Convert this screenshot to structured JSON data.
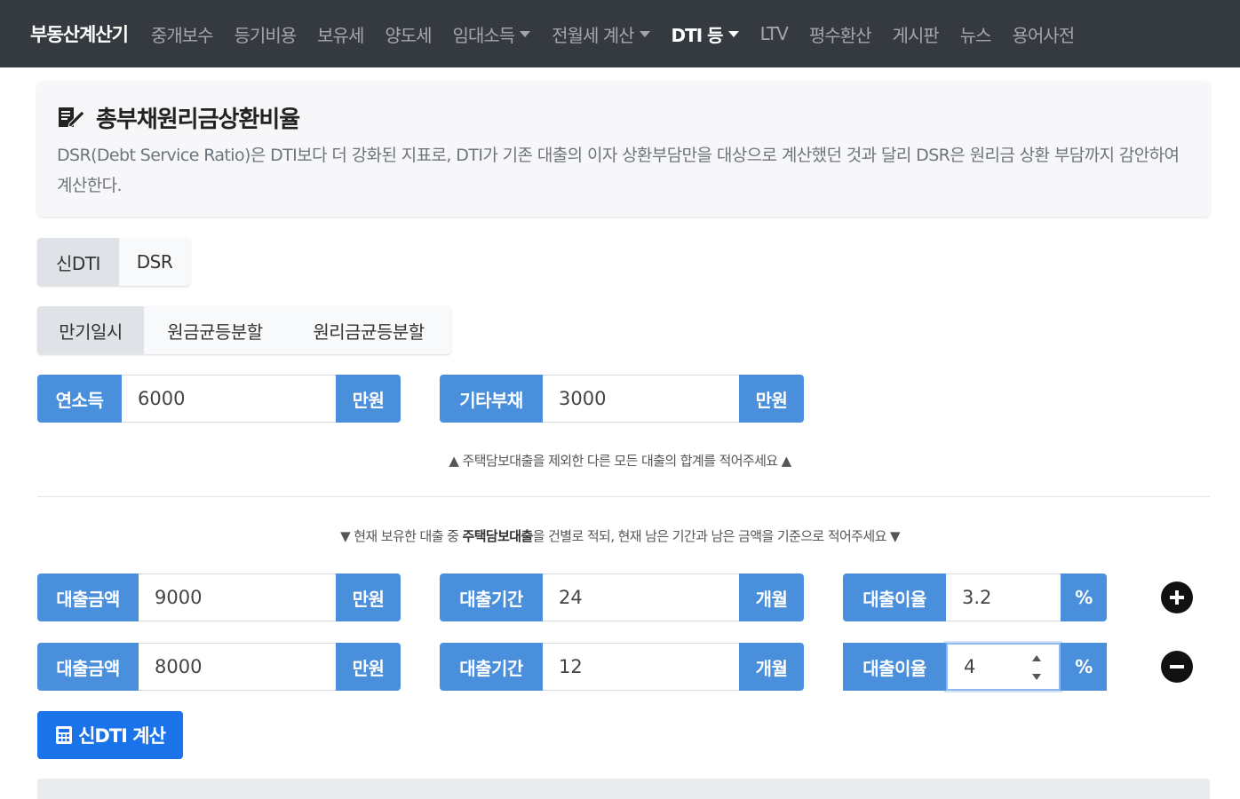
{
  "nav": {
    "brand": "부동산계산기",
    "items": [
      {
        "label": "중개보수",
        "dropdown": false,
        "active": false
      },
      {
        "label": "등기비용",
        "dropdown": false,
        "active": false
      },
      {
        "label": "보유세",
        "dropdown": false,
        "active": false
      },
      {
        "label": "양도세",
        "dropdown": false,
        "active": false
      },
      {
        "label": "임대소득",
        "dropdown": true,
        "active": false
      },
      {
        "label": "전월세 계산",
        "dropdown": true,
        "active": false
      },
      {
        "label": "DTI 등",
        "dropdown": true,
        "active": true
      },
      {
        "label": "LTV",
        "dropdown": false,
        "active": false
      },
      {
        "label": "평수환산",
        "dropdown": false,
        "active": false
      },
      {
        "label": "게시판",
        "dropdown": false,
        "active": false
      },
      {
        "label": "뉴스",
        "dropdown": false,
        "active": false
      },
      {
        "label": "용어사전",
        "dropdown": false,
        "active": false
      }
    ]
  },
  "header": {
    "icon": "edit-icon",
    "title": "총부채원리금상환비율",
    "description": "DSR(Debt Service Ratio)은 DTI보다 더 강화된 지표로, DTI가 기존 대출의 이자 상환부담만을 대상으로 계산했던 것과 달리 DSR은 원리금 상환 부담까지 감안하여 계산한다."
  },
  "mode_tabs": [
    {
      "label": "신DTI",
      "active": true
    },
    {
      "label": "DSR",
      "active": false
    }
  ],
  "repay_tabs": [
    {
      "label": "만기일시",
      "active": true
    },
    {
      "label": "원금균등분할",
      "active": false
    },
    {
      "label": "원리금균등분할",
      "active": false
    }
  ],
  "income": {
    "label": "연소득",
    "value": "6000",
    "unit": "만원"
  },
  "other_debt": {
    "label": "기타부채",
    "value": "3000",
    "unit": "만원"
  },
  "notes": {
    "other_debt_hint": "▲ 주택담보대출을 제외한 다른 모든 대출의 합계를 적어주세요 ▲",
    "loans_hint_pre": "▼ 현재 보유한 대출 중 ",
    "loans_hint_bold": "주택담보대출",
    "loans_hint_post": "을 건별로 적되, 현재 남은 기간과 남은 금액을 기준으로 적어주세요 ▼"
  },
  "loans": [
    {
      "amount_label": "대출금액",
      "amount": "9000",
      "amount_unit": "만원",
      "term_label": "대출기간",
      "term": "24",
      "term_unit": "개월",
      "rate_label": "대출이율",
      "rate": "3.2",
      "rate_unit": "%",
      "action_icon": "plus-circle-icon"
    },
    {
      "amount_label": "대출금액",
      "amount": "8000",
      "amount_unit": "만원",
      "term_label": "대출기간",
      "term": "12",
      "term_unit": "개월",
      "rate_label": "대출이율",
      "rate": "4",
      "rate_unit": "%",
      "action_icon": "minus-circle-icon"
    }
  ],
  "calculate": {
    "icon": "calculator-icon",
    "label": "신DTI 계산"
  },
  "colors": {
    "accent": "#4a8fdc",
    "button": "#1a73e8",
    "navbar": "#343a40"
  }
}
